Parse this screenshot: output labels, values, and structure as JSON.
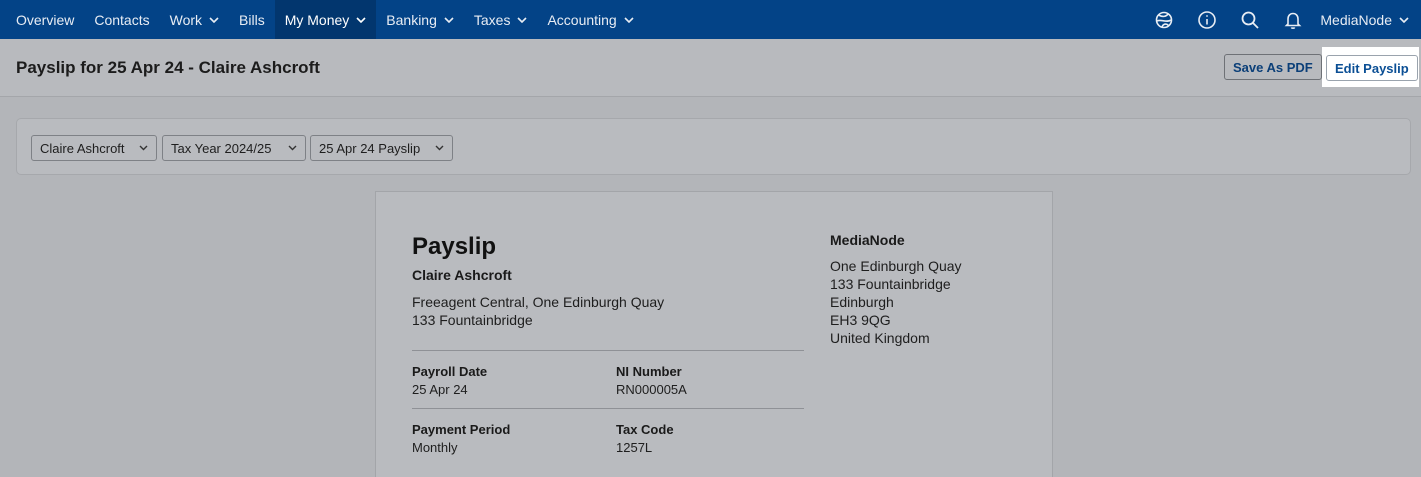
{
  "nav": {
    "items": [
      {
        "label": "Overview",
        "dropdown": false,
        "active": false
      },
      {
        "label": "Contacts",
        "dropdown": false,
        "active": false
      },
      {
        "label": "Work",
        "dropdown": true,
        "active": false
      },
      {
        "label": "Bills",
        "dropdown": false,
        "active": false
      },
      {
        "label": "My Money",
        "dropdown": true,
        "active": true
      },
      {
        "label": "Banking",
        "dropdown": true,
        "active": true
      },
      {
        "label": "Taxes",
        "dropdown": true,
        "active": false
      },
      {
        "label": "Accounting",
        "dropdown": true,
        "active": false
      }
    ],
    "icons": [
      "globe-icon",
      "info-icon",
      "search-icon",
      "bell-icon"
    ],
    "account_label": "MediaNode"
  },
  "header": {
    "title": "Payslip for 25 Apr 24 - Claire Ashcroft",
    "save_pdf_label": "Save As PDF",
    "edit_label": "Edit Payslip"
  },
  "filters": {
    "employee": "Claire Ashcroft",
    "tax_year": "Tax Year 2024/25",
    "payslip": "25 Apr 24 Payslip"
  },
  "payslip": {
    "title": "Payslip",
    "employee_name": "Claire Ashcroft",
    "employee_address": [
      "Freeagent Central, One Edinburgh Quay",
      "133 Fountainbridge"
    ],
    "fields": {
      "payroll_date_label": "Payroll Date",
      "payroll_date": "25 Apr 24",
      "ni_number_label": "NI Number",
      "ni_number": "RN000005A",
      "payment_period_label": "Payment Period",
      "payment_period": "Monthly",
      "tax_code_label": "Tax Code",
      "tax_code": "1257L"
    },
    "company_name": "MediaNode",
    "company_address": [
      "One Edinburgh Quay",
      "133 Fountainbridge",
      "Edinburgh",
      "EH3 9QG",
      "United Kingdom"
    ]
  },
  "colors": {
    "nav_bg": "#034387",
    "nav_active_bg": "#02366e",
    "link_blue": "#0b4f95",
    "overlay_gray": "#b9bbbf"
  }
}
